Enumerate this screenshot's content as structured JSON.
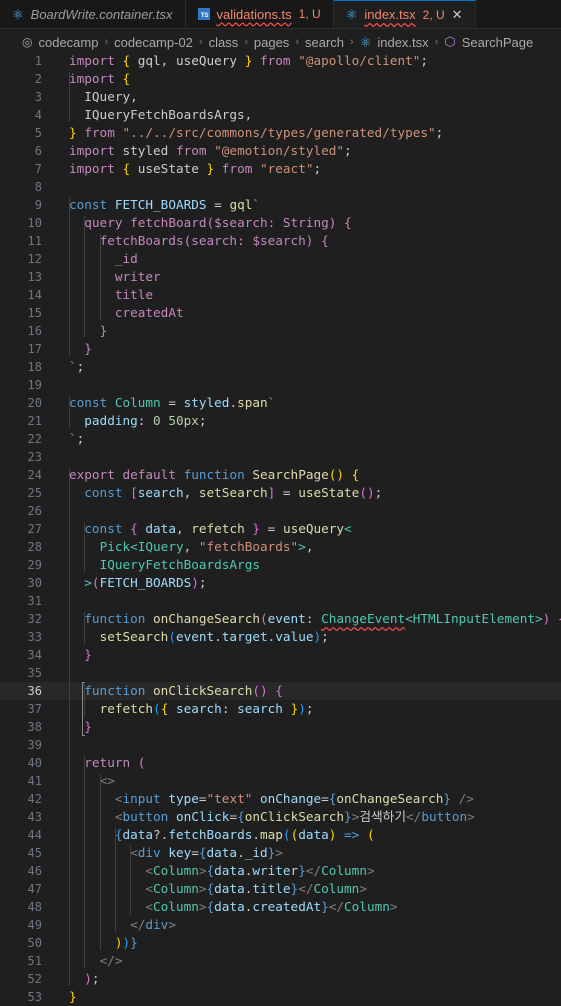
{
  "tabs": [
    {
      "icon": "react-icon",
      "name": "BoardWrite.container.tsx",
      "status": "",
      "style": "italic",
      "active": false
    },
    {
      "icon": "typescript-icon",
      "name": "validations.ts",
      "status": "1, U",
      "style": "err",
      "active": false
    },
    {
      "icon": "react-icon",
      "name": "index.tsx",
      "status": "2, U",
      "style": "err",
      "active": true
    }
  ],
  "breadcrumb": [
    "codecamp",
    "codecamp-02",
    "class",
    "pages",
    "search",
    "index.tsx",
    "SearchPage"
  ],
  "editor": {
    "current_line": 36,
    "lines": [
      {
        "n": "1",
        "code": [
          [
            "import",
            "c"
          ],
          " ",
          [
            "{",
            "b1"
          ],
          " gql, useQuery ",
          [
            "}",
            "b1"
          ],
          " ",
          [
            "from",
            "c"
          ],
          " ",
          [
            "\"@apollo/client\"",
            "s"
          ],
          ";"
        ]
      },
      {
        "n": "2",
        "code": [
          [
            "import",
            "c"
          ],
          " ",
          [
            "{",
            "b1"
          ]
        ]
      },
      {
        "n": "3",
        "code": [
          "  IQuery,"
        ]
      },
      {
        "n": "4",
        "code": [
          "  IQueryFetchBoardsArgs,"
        ]
      },
      {
        "n": "5",
        "code": [
          [
            "}",
            "b1"
          ],
          " ",
          [
            "from",
            "c"
          ],
          " ",
          [
            "\"../../src/commons/types/generated/types\"",
            "s"
          ],
          ";"
        ]
      },
      {
        "n": "6",
        "code": [
          [
            "import",
            "c"
          ],
          " styled ",
          [
            "from",
            "c"
          ],
          " ",
          [
            "\"@emotion/styled\"",
            "s"
          ],
          ";"
        ]
      },
      {
        "n": "7",
        "code": [
          [
            "import",
            "c"
          ],
          " ",
          [
            "{",
            "b1"
          ],
          " useState ",
          [
            "}",
            "b1"
          ],
          " ",
          [
            "from",
            "c"
          ],
          " ",
          [
            "\"react\"",
            "s"
          ],
          ";"
        ]
      },
      {
        "n": "8",
        "code": []
      },
      {
        "n": "9",
        "code": [
          [
            "const",
            "k"
          ],
          " ",
          [
            "FETCH_BOARDS",
            "v"
          ],
          " = ",
          [
            "gql",
            "f"
          ],
          [
            "`",
            "gq"
          ]
        ]
      },
      {
        "n": "10",
        "code": [
          "  ",
          [
            "query",
            "gq"
          ],
          " ",
          [
            "fetchBoard($search: String) {",
            "gq"
          ]
        ]
      },
      {
        "n": "11",
        "code": [
          "    ",
          [
            "fetchBoards(search: $search) {",
            "gq"
          ]
        ]
      },
      {
        "n": "12",
        "code": [
          "      ",
          [
            "_id",
            "gq"
          ]
        ]
      },
      {
        "n": "13",
        "code": [
          "      ",
          [
            "writer",
            "gq"
          ]
        ]
      },
      {
        "n": "14",
        "code": [
          "      ",
          [
            "title",
            "gq"
          ]
        ]
      },
      {
        "n": "15",
        "code": [
          "      ",
          [
            "createdAt",
            "gq"
          ]
        ]
      },
      {
        "n": "16",
        "code": [
          "    ",
          [
            "}",
            "gq"
          ]
        ]
      },
      {
        "n": "17",
        "code": [
          "  ",
          [
            "}",
            "gq"
          ]
        ]
      },
      {
        "n": "18",
        "code": [
          [
            "`",
            "gq"
          ],
          ";"
        ]
      },
      {
        "n": "19",
        "code": []
      },
      {
        "n": "20",
        "code": [
          [
            "const",
            "k"
          ],
          " ",
          [
            "Column",
            "t"
          ],
          " = ",
          [
            "styled",
            "v"
          ],
          ".",
          [
            "span",
            "f"
          ],
          [
            "`",
            "s"
          ]
        ]
      },
      {
        "n": "21",
        "code": [
          "  ",
          [
            "padding",
            "v"
          ],
          ": ",
          [
            "0",
            "n"
          ],
          " ",
          [
            "50px",
            "n"
          ],
          ";"
        ]
      },
      {
        "n": "22",
        "code": [
          [
            "`",
            "s"
          ],
          ";"
        ]
      },
      {
        "n": "23",
        "code": []
      },
      {
        "n": "24",
        "code": [
          [
            "export",
            "c"
          ],
          " ",
          [
            "default",
            "c"
          ],
          " ",
          [
            "function",
            "k"
          ],
          " ",
          [
            "SearchPage",
            "f"
          ],
          [
            "()",
            "b1"
          ],
          " ",
          [
            "{",
            "b1"
          ]
        ]
      },
      {
        "n": "25",
        "code": [
          "  ",
          [
            "const",
            "k"
          ],
          " ",
          [
            "[",
            "b2"
          ],
          [
            "search",
            "v"
          ],
          ", ",
          [
            "setSearch",
            "f"
          ],
          [
            "]",
            "b2"
          ],
          " = ",
          [
            "useState",
            "f"
          ],
          [
            "()",
            "b2"
          ],
          ";"
        ]
      },
      {
        "n": "26",
        "code": []
      },
      {
        "n": "27",
        "code": [
          "  ",
          [
            "const",
            "k"
          ],
          " ",
          [
            "{",
            "b2"
          ],
          " ",
          [
            "data",
            "v"
          ],
          ", ",
          [
            "refetch",
            "f"
          ],
          " ",
          [
            "}",
            "b2"
          ],
          " = ",
          [
            "useQuery",
            "f"
          ],
          [
            "<",
            "t"
          ]
        ]
      },
      {
        "n": "28",
        "code": [
          "    ",
          [
            "Pick",
            "t"
          ],
          [
            "<",
            "t"
          ],
          [
            "IQuery",
            "t"
          ],
          ", ",
          [
            "\"fetchBoards\"",
            "s"
          ],
          [
            ">",
            "t"
          ],
          ","
        ]
      },
      {
        "n": "29",
        "code": [
          "    ",
          [
            "IQueryFetchBoardsArgs",
            "t"
          ]
        ]
      },
      {
        "n": "30",
        "code": [
          "  ",
          [
            ">",
            "t"
          ],
          [
            "(",
            "b2"
          ],
          [
            "FETCH_BOARDS",
            "v"
          ],
          [
            ")",
            "b2"
          ],
          ";"
        ]
      },
      {
        "n": "31",
        "code": []
      },
      {
        "n": "32",
        "code": [
          "  ",
          [
            "function",
            "k"
          ],
          " ",
          [
            "onChangeSearch",
            "f"
          ],
          [
            "(",
            "b2"
          ],
          [
            "event",
            "v"
          ],
          ": ",
          [
            "ChangeEvent",
            "t err"
          ],
          [
            "<",
            "t"
          ],
          [
            "HTMLInputElement",
            "t"
          ],
          [
            ">",
            "t"
          ],
          [
            ")",
            "b2"
          ],
          " ",
          [
            "{",
            "b2"
          ]
        ]
      },
      {
        "n": "33",
        "code": [
          "    ",
          [
            "setSearch",
            "f"
          ],
          [
            "(",
            "b3"
          ],
          [
            "event",
            "v"
          ],
          ".",
          [
            "target",
            "v"
          ],
          ".",
          [
            "value",
            "v"
          ],
          [
            ")",
            "b3"
          ],
          ";"
        ]
      },
      {
        "n": "34",
        "code": [
          "  ",
          [
            "}",
            "b2"
          ]
        ]
      },
      {
        "n": "35",
        "code": []
      },
      {
        "n": "36",
        "code": [
          "  ",
          [
            "function",
            "k"
          ],
          " ",
          [
            "onClickSearch",
            "f"
          ],
          [
            "()",
            "b2"
          ],
          " ",
          [
            "{",
            "b2"
          ]
        ]
      },
      {
        "n": "37",
        "code": [
          "    ",
          [
            "refetch",
            "f"
          ],
          [
            "(",
            "b3"
          ],
          [
            "{",
            "b1"
          ],
          " ",
          [
            "search",
            "v"
          ],
          ": ",
          [
            "search",
            "v"
          ],
          " ",
          [
            "}",
            "b1"
          ],
          [
            ")",
            "b3"
          ],
          ";"
        ]
      },
      {
        "n": "38",
        "code": [
          "  ",
          [
            "}",
            "b2"
          ]
        ]
      },
      {
        "n": "39",
        "code": []
      },
      {
        "n": "40",
        "code": [
          "  ",
          [
            "return",
            "c"
          ],
          " ",
          [
            "(",
            "b2"
          ]
        ]
      },
      {
        "n": "41",
        "code": [
          "    ",
          [
            "<>",
            "g"
          ]
        ]
      },
      {
        "n": "42",
        "code": [
          "      ",
          [
            "<",
            "g"
          ],
          [
            "input",
            "tag"
          ],
          " ",
          [
            "type",
            "attr"
          ],
          "=",
          [
            "\"text\"",
            "s"
          ],
          " ",
          [
            "onChange",
            "attr"
          ],
          "=",
          [
            "{",
            "k"
          ],
          [
            "onChangeSearch",
            "f"
          ],
          [
            "}",
            "k"
          ],
          " ",
          [
            "/>",
            "g"
          ]
        ]
      },
      {
        "n": "43",
        "code": [
          "      ",
          [
            "<",
            "g"
          ],
          [
            "button",
            "tag"
          ],
          " ",
          [
            "onClick",
            "attr"
          ],
          "=",
          [
            "{",
            "k"
          ],
          [
            "onClickSearch",
            "f"
          ],
          [
            "}",
            "k"
          ],
          [
            ">",
            "g"
          ],
          "검색하기",
          [
            "</",
            "g"
          ],
          [
            "button",
            "tag"
          ],
          [
            ">",
            "g"
          ]
        ]
      },
      {
        "n": "44",
        "code": [
          "      ",
          [
            "{",
            "k"
          ],
          [
            "data",
            "v"
          ],
          "?.",
          [
            "fetchBoards",
            "v"
          ],
          ".",
          [
            "map",
            "f"
          ],
          [
            "(",
            "b3"
          ],
          [
            "(",
            "b1"
          ],
          [
            "data",
            "v"
          ],
          [
            ")",
            "b1"
          ],
          " ",
          [
            "=>",
            "k"
          ],
          " ",
          [
            "(",
            "b1"
          ]
        ]
      },
      {
        "n": "45",
        "code": [
          "        ",
          [
            "<",
            "g"
          ],
          [
            "div",
            "tag"
          ],
          " ",
          [
            "key",
            "attr"
          ],
          "=",
          [
            "{",
            "k"
          ],
          [
            "data",
            "v"
          ],
          ".",
          [
            "_id",
            "v"
          ],
          [
            "}",
            "k"
          ],
          [
            ">",
            "g"
          ]
        ]
      },
      {
        "n": "46",
        "code": [
          "          ",
          [
            "<",
            "g"
          ],
          [
            "Column",
            "jsx"
          ],
          [
            ">",
            "g"
          ],
          [
            "{",
            "k"
          ],
          [
            "data",
            "v"
          ],
          ".",
          [
            "writer",
            "v"
          ],
          [
            "}",
            "k"
          ],
          [
            "</",
            "g"
          ],
          [
            "Column",
            "jsx"
          ],
          [
            ">",
            "g"
          ]
        ]
      },
      {
        "n": "47",
        "code": [
          "          ",
          [
            "<",
            "g"
          ],
          [
            "Column",
            "jsx"
          ],
          [
            ">",
            "g"
          ],
          [
            "{",
            "k"
          ],
          [
            "data",
            "v"
          ],
          ".",
          [
            "title",
            "v"
          ],
          [
            "}",
            "k"
          ],
          [
            "</",
            "g"
          ],
          [
            "Column",
            "jsx"
          ],
          [
            ">",
            "g"
          ]
        ]
      },
      {
        "n": "48",
        "code": [
          "          ",
          [
            "<",
            "g"
          ],
          [
            "Column",
            "jsx"
          ],
          [
            ">",
            "g"
          ],
          [
            "{",
            "k"
          ],
          [
            "data",
            "v"
          ],
          ".",
          [
            "createdAt",
            "v"
          ],
          [
            "}",
            "k"
          ],
          [
            "</",
            "g"
          ],
          [
            "Column",
            "jsx"
          ],
          [
            ">",
            "g"
          ]
        ]
      },
      {
        "n": "49",
        "code": [
          "        ",
          [
            "</",
            "g"
          ],
          [
            "div",
            "tag"
          ],
          [
            ">",
            "g"
          ]
        ]
      },
      {
        "n": "50",
        "code": [
          "      ",
          [
            ")",
            "b1"
          ],
          [
            ")",
            "b3"
          ],
          [
            "}",
            "k"
          ]
        ]
      },
      {
        "n": "51",
        "code": [
          "    ",
          [
            "</>",
            "g"
          ]
        ]
      },
      {
        "n": "52",
        "code": [
          "  ",
          [
            ")",
            "b2"
          ],
          ";"
        ]
      },
      {
        "n": "53",
        "code": [
          [
            "}",
            "b1"
          ]
        ]
      }
    ]
  }
}
